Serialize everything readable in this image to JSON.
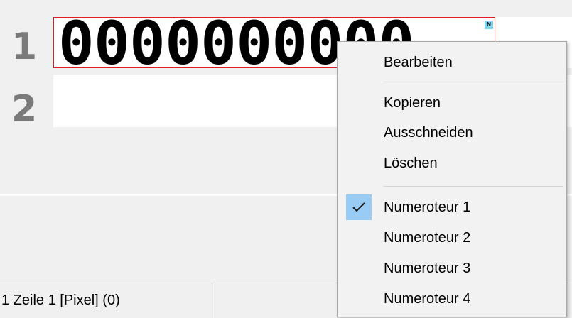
{
  "lines": [
    {
      "number": "1",
      "content": "0000000000"
    },
    {
      "number": "2",
      "content": ""
    }
  ],
  "marker": "N",
  "status": {
    "cell1": "1 Zeile 1 [Pixel] (0)",
    "cell2": ""
  },
  "context_menu": {
    "edit": "Bearbeiten",
    "copy": "Kopieren",
    "cut": "Ausschneiden",
    "delete": "Löschen",
    "numerators": [
      "Numeroteur 1",
      "Numeroteur 2",
      "Numeroteur 3",
      "Numeroteur 4"
    ],
    "checked": "Numeroteur 1"
  },
  "colors": {
    "selection_frame": "#e02020",
    "check_highlight": "#99ccf5",
    "marker_bg": "#7fd7ee"
  }
}
